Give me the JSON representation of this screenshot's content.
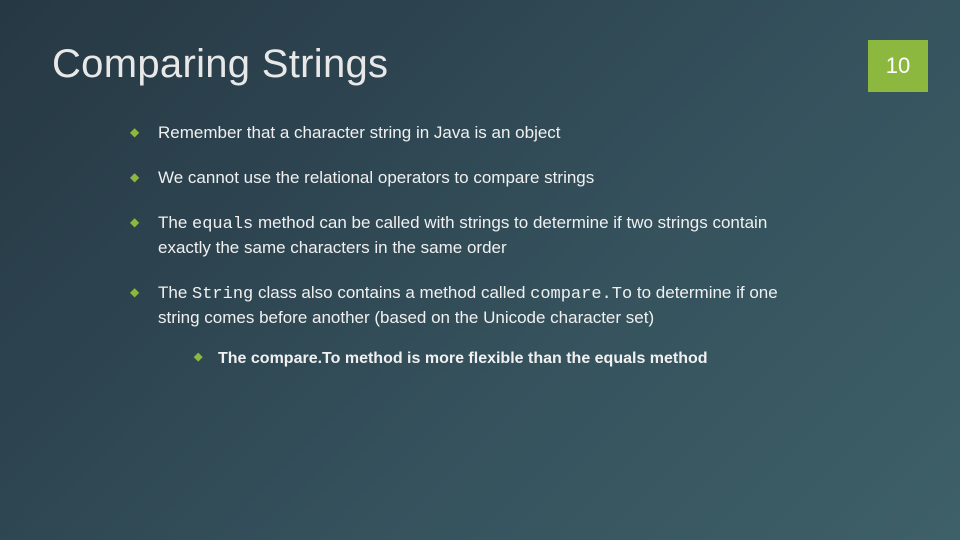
{
  "title": "Comparing Strings",
  "page_number": "10",
  "bullets": {
    "b1": "Remember that a character string in Java is an object",
    "b2": "We cannot use the relational operators to compare strings",
    "b3_pre": "The ",
    "b3_code": "equals",
    "b3_post": " method can be called with strings to determine if two strings contain exactly the same characters in the same order",
    "b4_pre": "The ",
    "b4_code1": "String",
    "b4_mid": " class also contains a method called ",
    "b4_code2": "compare.To",
    "b4_post": " to determine if one string comes before another (based on the Unicode character set)",
    "sub1": "The compare.To method is more flexible than the equals method"
  },
  "colors": {
    "accent": "#8cb83f"
  }
}
